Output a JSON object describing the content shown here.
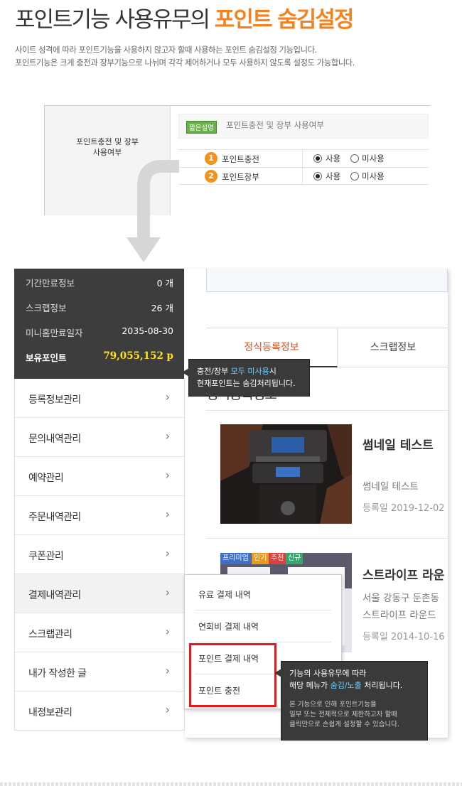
{
  "header": {
    "title_main": "포인트기능 사용유무의",
    "title_highlight": "포인트 숨김설정",
    "desc_line1": "사이트 성격에 따라 포인트기능을 사용하지 않고자 할때 사용하는 포인트 숨김설정 기능입니다.",
    "desc_line2": "포인트기능은 크게 충전과 장부기능으로 나뉘며 각각 제어하거나 모두 사용하지 않도록 설정도 가능합니다."
  },
  "settings": {
    "section_label_line1": "포인트충전 및 장부",
    "section_label_line2": "사용여부",
    "help_badge": "짧은설명",
    "help_text": "포인트충전 및 장부 사용여부",
    "rows": [
      {
        "num": "1",
        "label": "포인트충전",
        "opt_use": "사용",
        "opt_nouse": "미사용",
        "selected": "사용"
      },
      {
        "num": "2",
        "label": "포인트장부",
        "opt_use": "사용",
        "opt_nouse": "미사용",
        "selected": "사용"
      }
    ]
  },
  "sidebar": {
    "info": [
      {
        "label": "기간만료정보",
        "value": "0 개"
      },
      {
        "label": "스크랩정보",
        "value": "26 개"
      },
      {
        "label": "미니홈만료일자",
        "value": "2035-08-30"
      },
      {
        "label": "보유포인트",
        "value": "79,055,152 p"
      }
    ],
    "menu": [
      {
        "label": "등록정보관리"
      },
      {
        "label": "문의내역관리"
      },
      {
        "label": "예약관리"
      },
      {
        "label": "주문내역관리"
      },
      {
        "label": "쿠폰관리"
      },
      {
        "label": "결제내역관리"
      },
      {
        "label": "스크랩관리"
      },
      {
        "label": "내가 작성한 글"
      },
      {
        "label": "내정보관리"
      }
    ],
    "chevron": "›"
  },
  "submenu": {
    "items": [
      {
        "label": "유료 결제 내역"
      },
      {
        "label": "연회비 결제 내역"
      },
      {
        "label": "포인트 결제 내역"
      },
      {
        "label": "포인트 충전"
      }
    ]
  },
  "content": {
    "tabs": [
      {
        "label": "정식등록정보"
      },
      {
        "label": "스크랩정보"
      }
    ],
    "section_title": "정식등록정보",
    "cards": [
      {
        "title": "썸네일 테스트",
        "subtitle": "썸네일 테스트",
        "date": "등록일 2019-12-02"
      },
      {
        "title": "스트라이프 라운",
        "subtitle": "서울 강동구 둔촌동",
        "subtitle2": "스트라이프 라운드",
        "date": "등록일 2014-10-16",
        "tags": [
          {
            "label": "프리미엄",
            "color": "#3b6fc8"
          },
          {
            "label": "인기",
            "color": "#e89a1e"
          },
          {
            "label": "추천",
            "color": "#d94040"
          },
          {
            "label": "신규",
            "color": "#33a86c"
          }
        ]
      }
    ]
  },
  "tooltips": {
    "tip1_line1_pre": "충전/장부",
    "tip1_line1_hl": "모두 미사용",
    "tip1_line1_post": "시",
    "tip1_line2": "현재포인트는 숨김처리됩니다.",
    "tip2_line1": "기능의 사용유무에 따라",
    "tip2_line2_pre": "해당 메뉴가",
    "tip2_line2_hl": "숨김/노출",
    "tip2_line2_post": "처리됩니다.",
    "tip2_note1": "본 기능으로 인해 포인트기능을",
    "tip2_note2": "일부 또는 전체적으로 제한하고자 할때",
    "tip2_note3": "클릭만으로 손쉽게 설정할 수 있습니다."
  },
  "colors": {
    "accent_orange": "#f5821f",
    "points_yellow": "#ffe21d",
    "highlight_blue": "#68d3ff",
    "red_box": "#e8161d"
  }
}
